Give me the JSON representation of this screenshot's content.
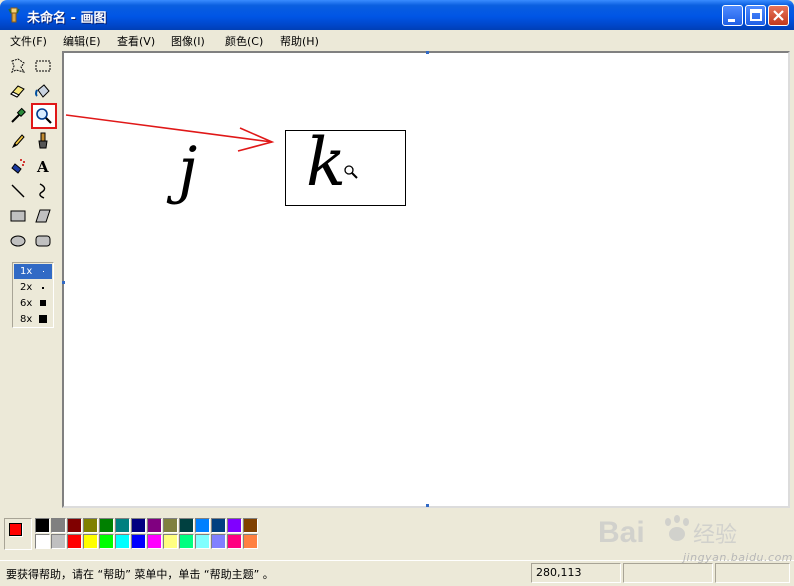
{
  "window": {
    "title": "未命名 - 画图",
    "icon": "paint-app-icon",
    "controls": [
      "minimize-icon",
      "maximize-icon",
      "close-icon"
    ]
  },
  "menu": {
    "items": [
      "文件(F)",
      "编辑(E)",
      "查看(V)",
      "图像(I)",
      "颜色(C)",
      "帮助(H)"
    ]
  },
  "toolbox": {
    "tools": [
      "free-form-select-icon",
      "rect-select-icon",
      "eraser-icon",
      "fill-bucket-icon",
      "color-picker-icon",
      "magnifier-icon",
      "pencil-icon",
      "brush-icon",
      "airbrush-icon",
      "text-icon",
      "line-icon",
      "curve-icon",
      "rectangle-icon",
      "polygon-icon",
      "ellipse-icon",
      "rounded-rect-icon"
    ],
    "selected_tool": "magnifier-icon",
    "text_tool_glyph": "A",
    "zoom_options": [
      "1x",
      "2x",
      "6x",
      "8x"
    ],
    "selected_zoom": "1x"
  },
  "canvas": {
    "letter_drawn": "j",
    "zoom_preview_letter": "k",
    "annotation": {
      "color": "#e01818"
    }
  },
  "palette": {
    "foreground": "#ff0000",
    "background": "#ffffff",
    "row1": [
      "#000000",
      "#808080",
      "#800000",
      "#808000",
      "#008000",
      "#008080",
      "#000080",
      "#800080",
      "#808040",
      "#004040",
      "#0080ff",
      "#004080",
      "#8000ff",
      "#804000"
    ],
    "row2": [
      "#ffffff",
      "#c0c0c0",
      "#ff0000",
      "#ffff00",
      "#00ff00",
      "#00ffff",
      "#0000ff",
      "#ff00ff",
      "#ffff80",
      "#00ff80",
      "#80ffff",
      "#8080ff",
      "#ff0080",
      "#ff8040"
    ]
  },
  "status": {
    "help_text": "要获得帮助，请在 “帮助” 菜单中，单击 “帮助主题” 。",
    "coords": "280,113"
  },
  "watermark": {
    "brand": "Bai",
    "brand_suffix": "经验",
    "url": "jingyan.baidu.com"
  }
}
